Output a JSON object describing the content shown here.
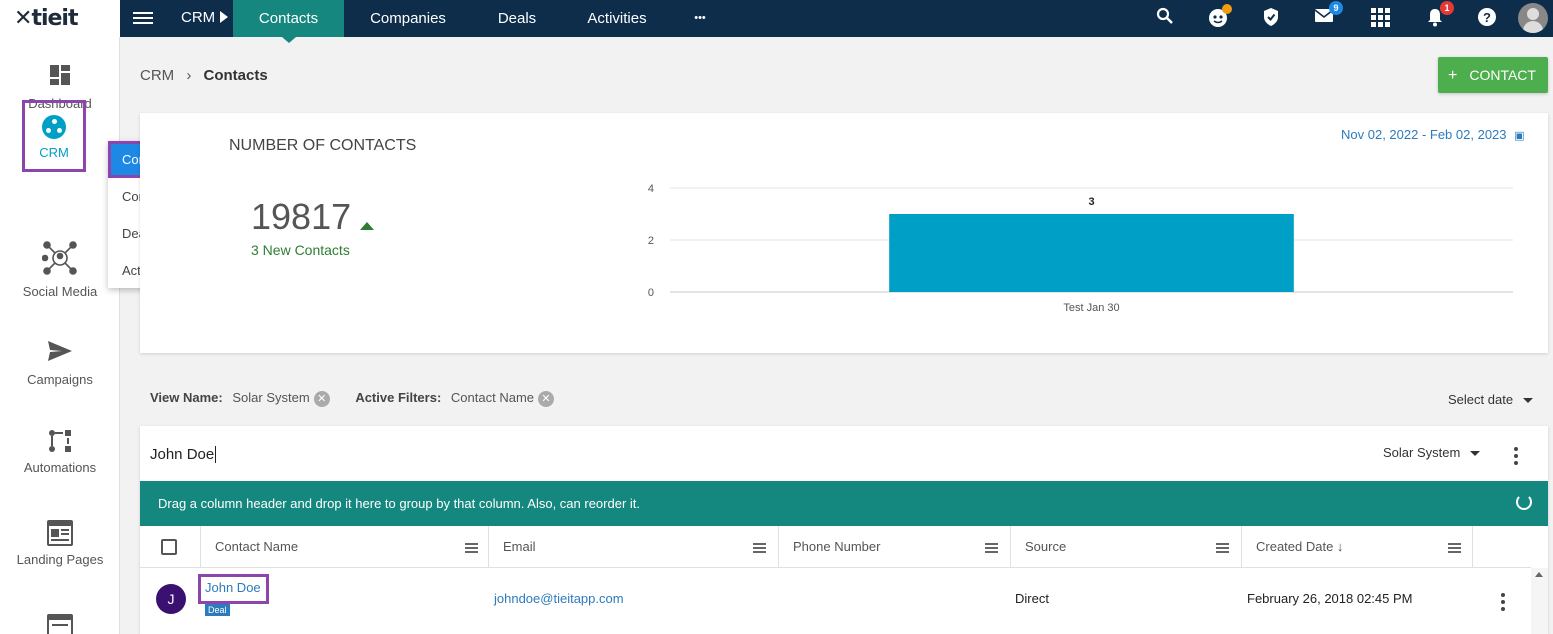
{
  "app": {
    "logo_text": "tieit"
  },
  "topbar": {
    "crumb": "CRM",
    "tabs": [
      {
        "label": "Contacts",
        "active": true
      },
      {
        "label": "Companies",
        "active": false
      },
      {
        "label": "Deals",
        "active": false
      },
      {
        "label": "Activities",
        "active": false
      }
    ],
    "more_label": "•••",
    "icons": [
      "search-icon",
      "assistant-icon",
      "shield-icon",
      "mail-icon",
      "apps-grid-icon",
      "bell-icon",
      "help-icon",
      "user-avatar"
    ],
    "mail_badge": "9",
    "notifications_badge": "1"
  },
  "sidebar": {
    "items": [
      {
        "label": "Dashboard",
        "icon": "dashboard-icon"
      },
      {
        "label": "CRM",
        "icon": "crm-icon",
        "active": true
      },
      {
        "label": "Social Media",
        "icon": "social-network-icon"
      },
      {
        "label": "Campaigns",
        "icon": "send-icon"
      },
      {
        "label": "Automations",
        "icon": "automation-icon"
      },
      {
        "label": "Landing Pages",
        "icon": "landing-page-icon"
      }
    ]
  },
  "submenu": {
    "items": [
      "Contacts",
      "Companies",
      "Deals",
      "Activities"
    ]
  },
  "page": {
    "breadcrumb_root": "CRM",
    "breadcrumb_sep": "›",
    "breadcrumb_current": "Contacts",
    "add_button": "CONTACT",
    "add_icon": "+"
  },
  "summary": {
    "title": "NUMBER OF CONTACTS",
    "date_range": "Nov 02, 2022 - Feb 02, 2023",
    "total": "19817",
    "new_text": "3 New Contacts"
  },
  "chart_data": {
    "type": "bar",
    "categories": [
      "Test Jan 30"
    ],
    "values": [
      3
    ],
    "data_labels": [
      "3"
    ],
    "yticks": [
      0,
      2,
      4
    ],
    "ylim": [
      0,
      4
    ],
    "bar_color": "#00a0c6",
    "grid": true
  },
  "filters": {
    "view_name_label": "View Name:",
    "view_name_value": "Solar System",
    "active_filters_label": "Active Filters:",
    "active_filter_value": "Contact Name",
    "select_date": "Select date"
  },
  "grid": {
    "search_value": "John Doe",
    "view_select": "Solar System",
    "group_hint": "Drag a column header and drop it here to group by that column. Also, can reorder it.",
    "columns": [
      "Contact Name",
      "Email",
      "Phone Number",
      "Source",
      "Created Date ↓"
    ],
    "rows": [
      {
        "initial": "J",
        "name": "John Doe",
        "tag": "Deal",
        "email": "johndoe@tieitapp.com",
        "phone": "",
        "source": "Direct",
        "created": "February 26, 2018 02:45 PM"
      }
    ]
  },
  "colors": {
    "topbar": "#0d2d4a",
    "active_tab": "#15877f",
    "accent_blue": "#1e88e5",
    "green_button": "#4cae4c",
    "highlight": "#8e44ad"
  }
}
